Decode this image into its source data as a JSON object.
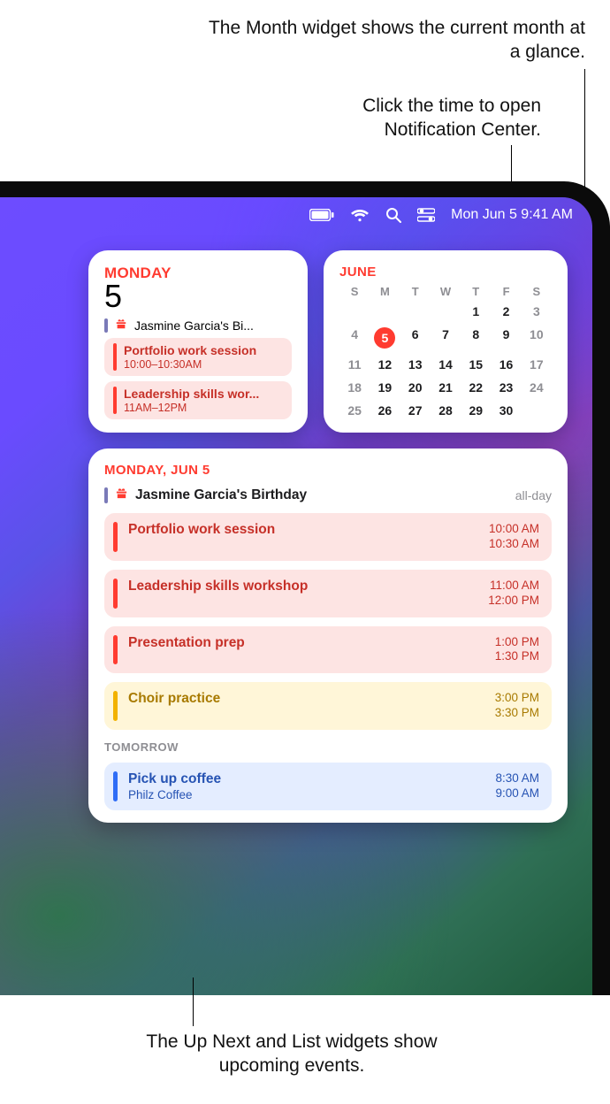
{
  "callouts": {
    "month": "The Month widget shows the current month at a glance.",
    "time": "Click the time to open Notification Center.",
    "list": "The Up Next and List widgets show upcoming events."
  },
  "menubar": {
    "datetime": "Mon Jun 5  9:41 AM"
  },
  "upnext": {
    "weekday": "Monday",
    "dayNumber": "5",
    "birthday": "Jasmine Garcia's Bi...",
    "items": [
      {
        "title": "Portfolio work session",
        "time": "10:00–10:30AM"
      },
      {
        "title": "Leadership skills wor...",
        "time": "11AM–12PM"
      }
    ]
  },
  "month": {
    "title": "JUNE",
    "dow": [
      "S",
      "M",
      "T",
      "W",
      "T",
      "F",
      "S"
    ],
    "today": 5,
    "leadingBlanks": 4,
    "days": 30
  },
  "list": {
    "date": "MONDAY, JUN 5",
    "birthday": {
      "name": "Jasmine Garcia's Birthday",
      "tag": "all-day"
    },
    "events": [
      {
        "title": "Portfolio work session",
        "t1": "10:00 AM",
        "t2": "10:30 AM",
        "color": "red"
      },
      {
        "title": "Leadership skills workshop",
        "t1": "11:00 AM",
        "t2": "12:00 PM",
        "color": "red"
      },
      {
        "title": "Presentation prep",
        "t1": "1:00 PM",
        "t2": "1:30 PM",
        "color": "red"
      },
      {
        "title": "Choir practice",
        "t1": "3:00 PM",
        "t2": "3:30 PM",
        "color": "yellow"
      }
    ],
    "tomorrowLabel": "TOMORROW",
    "tomorrow": [
      {
        "title": "Pick up coffee",
        "sub": "Philz Coffee",
        "t1": "8:30 AM",
        "t2": "9:00 AM",
        "color": "blue"
      }
    ]
  }
}
